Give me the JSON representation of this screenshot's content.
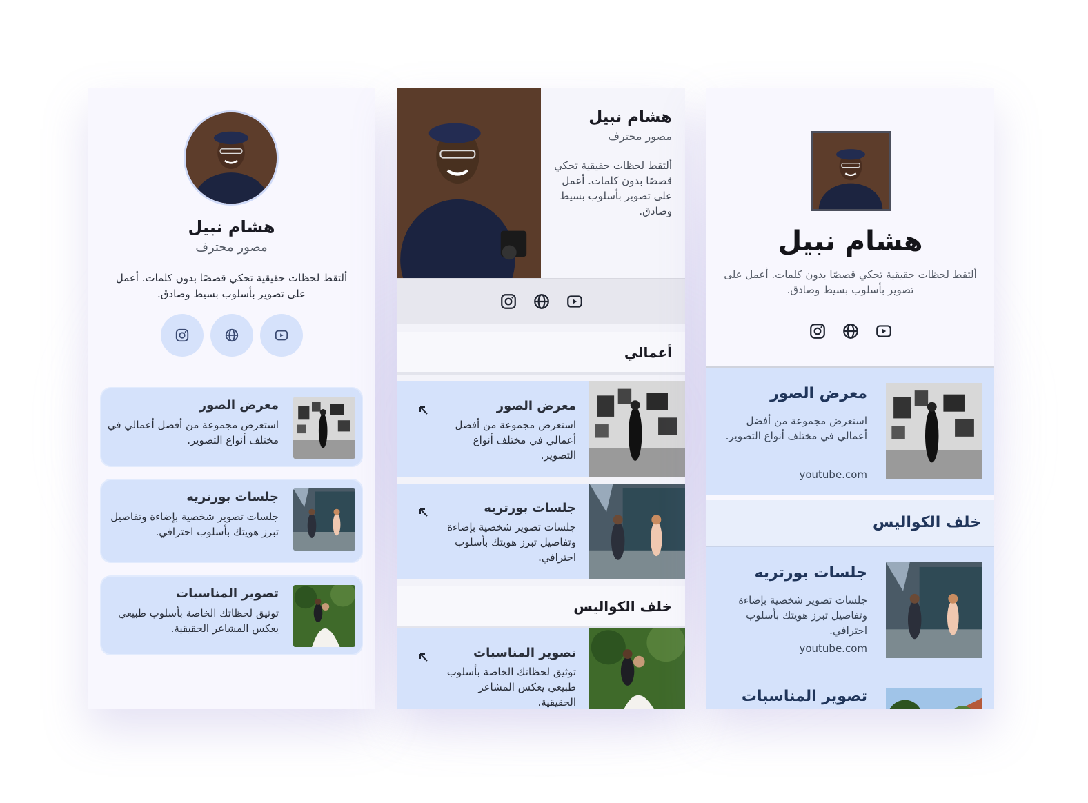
{
  "profile": {
    "name": "هشام نبيل",
    "role": "مصور محترف",
    "bio": "ألتقط لحظات حقيقية تحكي قصصًا بدون كلمات. أعمل على تصوير  بأسلوب بسيط وصادق."
  },
  "social_icons": [
    "instagram-icon",
    "globe-icon",
    "youtube-icon"
  ],
  "sections": {
    "works": "أعمالي",
    "behind_scenes": "خلف الكواليس"
  },
  "items": [
    {
      "title": "معرض الصور",
      "desc": "استعرض مجموعة من أفضل أعمالي في مختلف أنواع التصوير.",
      "link": "youtube.com"
    },
    {
      "title": "جلسات بورتريه",
      "desc": "جلسات تصوير شخصية بإضاءة وتفاصيل تبرز هويتك بأسلوب احترافي.",
      "link": "youtube.com"
    },
    {
      "title": "تصوير المناسبات",
      "desc": "توثيق لحظاتك الخاصة بأسلوب طبيعي يعكس المشاعر الحقيقية."
    }
  ],
  "colors": {
    "card_bg": "#f8f7fe",
    "item_bg": "#d5e2fb",
    "accent_text": "#20355a"
  }
}
